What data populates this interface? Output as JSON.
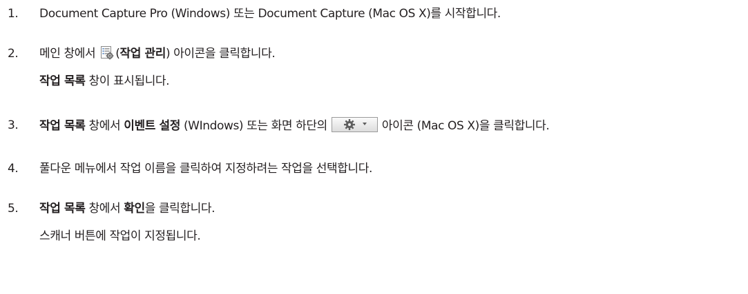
{
  "steps": [
    {
      "number": "1.",
      "text": "Document Capture Pro (Windows) 또는 Document Capture (Mac OS X)를 시작합니다."
    },
    {
      "number": "2.",
      "pre": "메인 창에서 ",
      "open_paren": "(",
      "bold": "작업 관리",
      "post": ") 아이콘을 클릭합니다.",
      "icon": "task-manager-icon",
      "result_bold": "작업 목록",
      "result_post": " 창이 표시됩니다."
    },
    {
      "number": "3.",
      "bold1": "작업 목록",
      "mid1": " 창에서 ",
      "bold2": "이벤트 설정",
      "mid2": " (WIndows) 또는 화면 하단의 ",
      "icon": "gear-dropdown-icon",
      "post": " 아이콘 (Mac OS X)을 클릭합니다."
    },
    {
      "number": "4.",
      "text": "풀다운 메뉴에서 작업 이름을 클릭하여 지정하려는 작업을 선택합니다."
    },
    {
      "number": "5.",
      "bold1": "작업 목록",
      "mid1": " 창에서 ",
      "bold2": "확인",
      "post": "을 클릭합니다.",
      "result": "스캐너 버튼에 작업이 지정됩니다."
    }
  ]
}
